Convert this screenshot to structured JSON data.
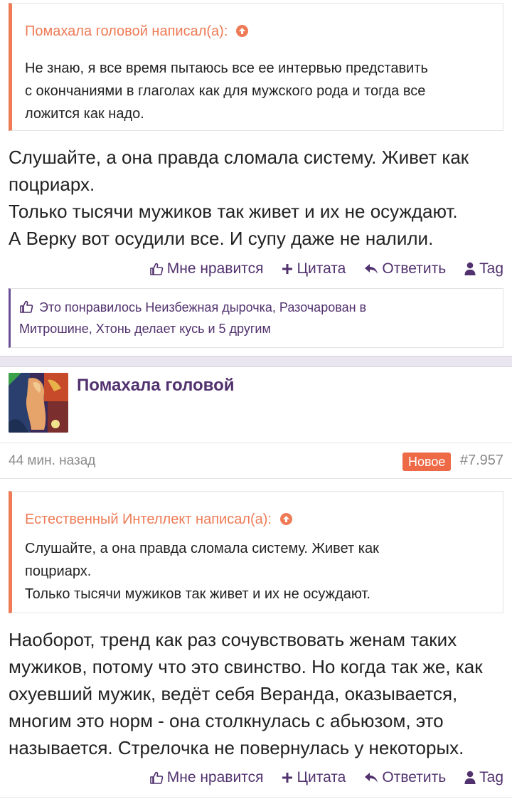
{
  "post1": {
    "quote": {
      "author_line": "Помахала головой написал(а):",
      "lines": [
        "Не знаю, я все время пытаюсь все ее интервью представить",
        "с окончаниями в глаголах как для мужского рода и тогда все",
        "ложится как надо."
      ]
    },
    "body_lines": [
      "Слушайте, а она правда сломала систему. Живет как",
      "поцриарх.",
      "Только тысячи мужиков так живет и их не осуждают.",
      "А Верку вот осудили все. И супу даже не налили."
    ],
    "actions": {
      "like": "Мне нравится",
      "quote": "Цитата",
      "reply": "Ответить",
      "tag": "Tag"
    },
    "likes": {
      "line1": "Это понравилось Неизбежная дырочка, Разочарован в",
      "line2": "Митрошине, Хтонь делает кусь и 5 другим"
    }
  },
  "post2": {
    "author": "Помахала головой",
    "time": "44 мин. назад",
    "badge": "Новое",
    "number": "#7.957",
    "quote": {
      "author_line": "Естественный Интеллект написал(а):",
      "lines": [
        "Слушайте, а она правда сломала систему. Живет как",
        "поцриарх.",
        "Только тысячи мужиков так живет и их не осуждают."
      ]
    },
    "body_lines": [
      "Наоборот, тренд как раз сочувствовать женам таких",
      "мужиков, потому что это свинство. Но когда так же, как",
      "охуевший мужик, ведёт себя Веранда, оказывается,",
      "многим это норм - она столкнулась с абьюзом, это",
      "называется. Стрелочка не повернулась у некоторых."
    ],
    "actions": {
      "like": "Мне нравится",
      "quote": "Цитата",
      "reply": "Ответить",
      "tag": "Tag"
    }
  },
  "colors": {
    "accent": "#ee7b56",
    "brand": "#51316e",
    "badge": "#ee6a47"
  }
}
